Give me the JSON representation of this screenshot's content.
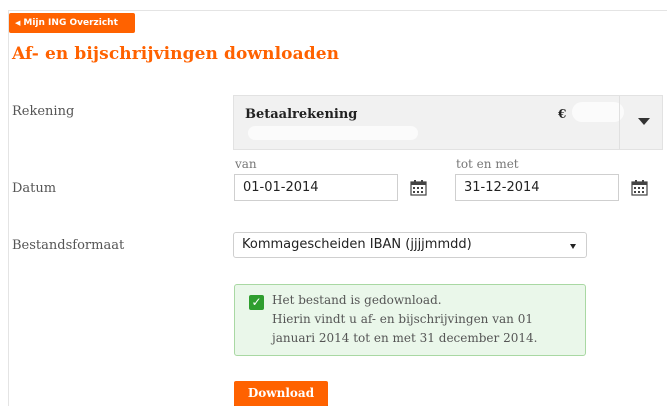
{
  "nav": {
    "back_label": "Mijn ING Overzicht"
  },
  "page": {
    "title": "Af- en bijschrijvingen downloaden"
  },
  "account": {
    "label": "Rekening",
    "name": "Betaalrekening",
    "currency": "€"
  },
  "date": {
    "label": "Datum",
    "from_label": "van",
    "from_value": "01-01-2014",
    "to_label": "tot en met",
    "to_value": "31-12-2014"
  },
  "format": {
    "label": "Bestandsformaat",
    "selected": "Kommagescheiden IBAN (jjjjmmdd)"
  },
  "message": {
    "line1": "Het bestand is gedownload.",
    "line2": "Hierin vindt u af- en bijschrijvingen van 01",
    "line3": "januari 2014 tot en met 31 december 2014."
  },
  "actions": {
    "download_label": "Download"
  },
  "colors": {
    "brand": "#ff6200",
    "success_bg": "#eaf7ea",
    "success_border": "#a9d8a3",
    "check": "#2f9e2f"
  },
  "icons": [
    "chevron-left-icon",
    "dropdown-caret-icon",
    "calendar-icon",
    "check-icon"
  ]
}
